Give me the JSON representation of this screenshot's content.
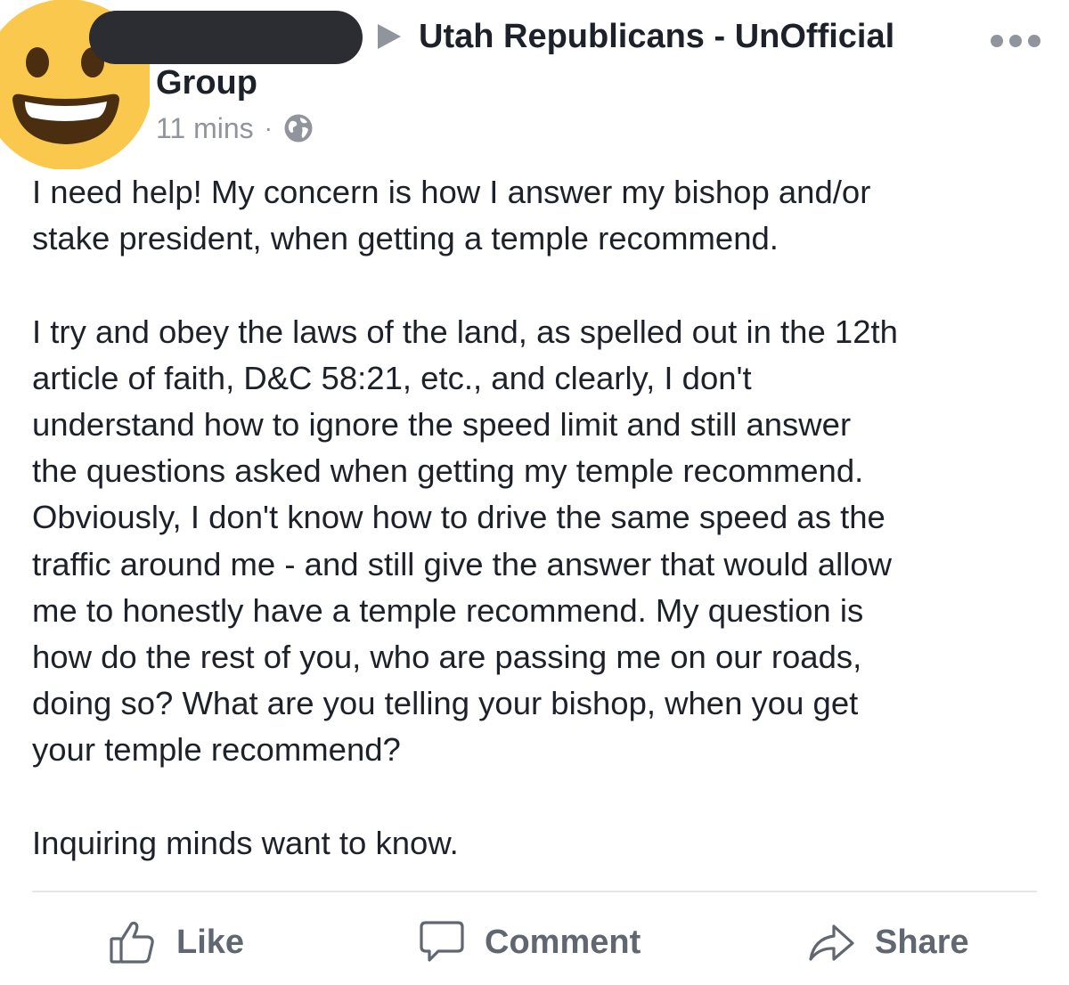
{
  "post": {
    "group_name_line1": "Utah Republicans - UnOfficial",
    "group_name_line2": "Group",
    "timestamp": "11 mins",
    "separator": "·",
    "privacy_icon": "globe-icon",
    "menu_icon": "more-options-icon",
    "body": {
      "paragraph1": [
        "I need help!  My concern is how I answer my bishop and/or",
        "stake president, when getting a temple recommend."
      ],
      "paragraph2": [
        "I try and obey the laws of the land, as spelled out in the 12th",
        "article of faith, D&C 58:21, etc., and clearly, I don't",
        "understand how to ignore the speed limit and still answer",
        "the questions asked when getting my temple recommend.",
        "Obviously, I don't know how to drive the same speed as the",
        "traffic around me - and still give the answer that would allow",
        "me to honestly have a temple recommend.  My question is",
        "how do the rest of you, who are passing me on our roads,",
        "doing so?  What are you telling your bishop, when you get",
        "your temple recommend?"
      ],
      "paragraph3": [
        "Inquiring minds want to know."
      ]
    }
  },
  "actions": {
    "like_label": "Like",
    "comment_label": "Comment",
    "share_label": "Share"
  },
  "colors": {
    "text": "#1d2129",
    "secondary": "#90949c",
    "action": "#606770",
    "divider": "#e5e6e9",
    "emoji_face": "#f9c84c",
    "emoji_features": "#4a2e0f",
    "redaction": "#2b2d33"
  }
}
